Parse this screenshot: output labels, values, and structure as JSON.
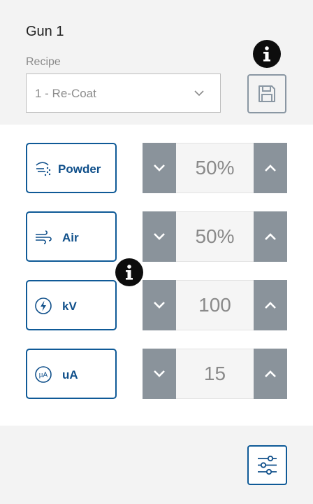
{
  "header": {
    "gun_title": "Gun 1"
  },
  "recipe": {
    "label": "Recipe",
    "selected": "1 - Re-Coat"
  },
  "parameters": [
    {
      "label": "Powder",
      "icon": "powder-icon",
      "value": "50%"
    },
    {
      "label": "Air",
      "icon": "air-icon",
      "value": "50%"
    },
    {
      "label": "kV",
      "icon": "voltage-icon",
      "value": "100"
    },
    {
      "label": "uA",
      "icon": "microamp-icon",
      "value": "15",
      "icon_text": "µA"
    }
  ],
  "colors": {
    "accent": "#0f5a97",
    "stepper_button": "#8a939b",
    "info_badge": "#0d0d0d"
  }
}
